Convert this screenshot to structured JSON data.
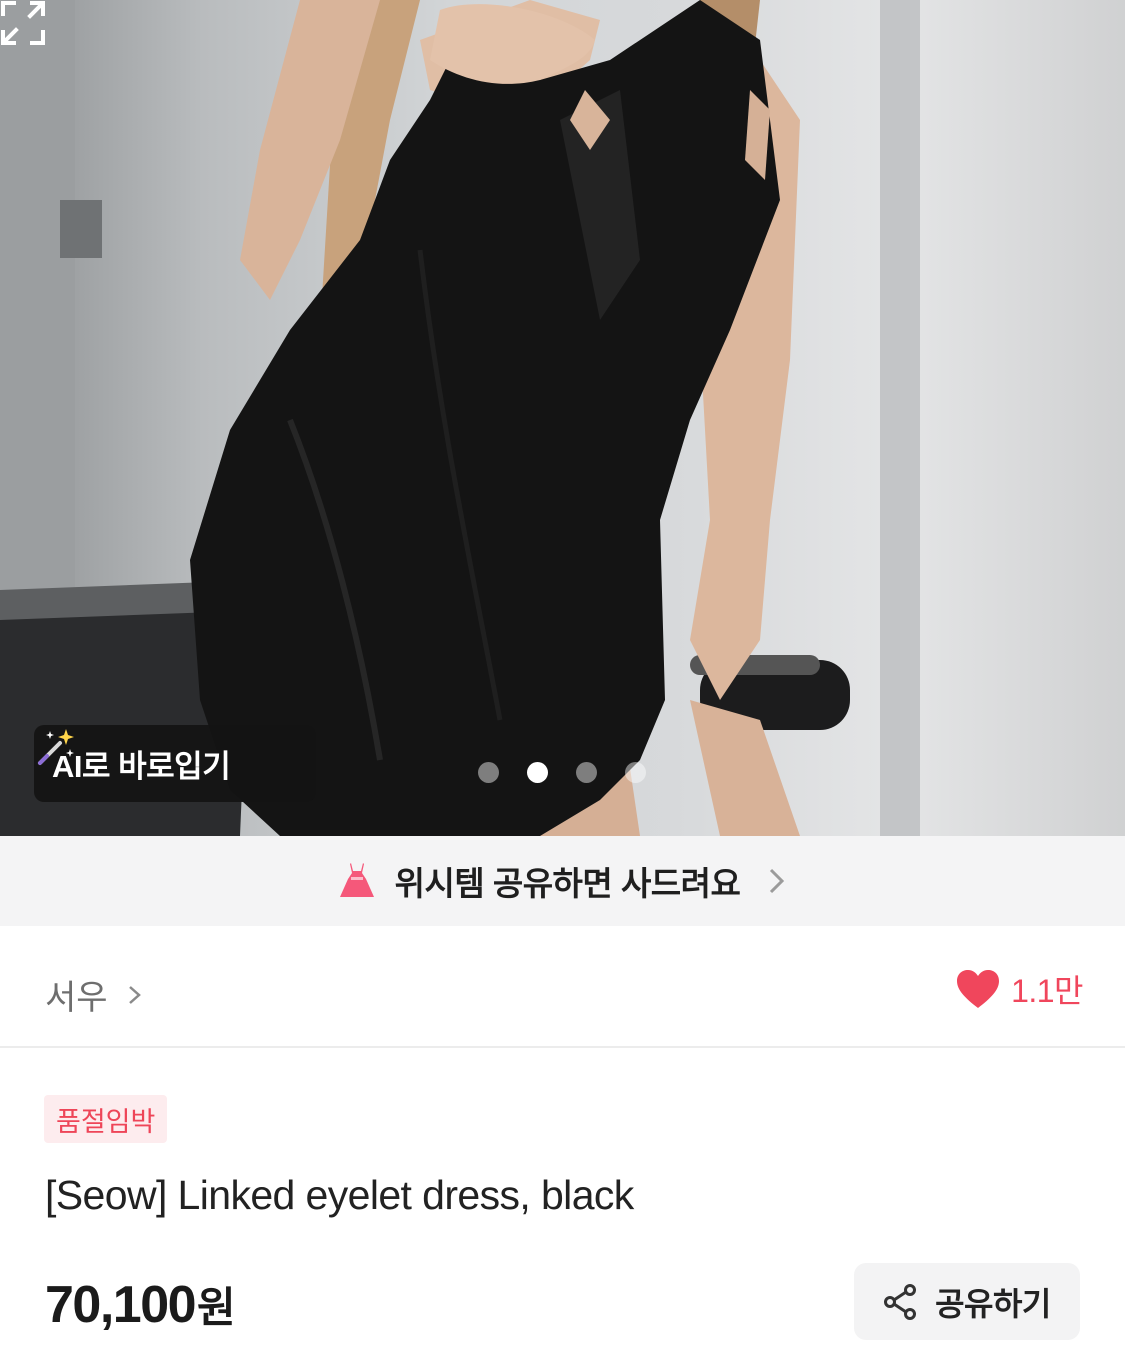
{
  "gallery": {
    "image_alt": "model wearing black linked eyelet dress",
    "ai_try_on_label": "AI로 바로입기",
    "total_images": 4,
    "active_index": 1,
    "icons": {
      "ai": "magic-wand-icon",
      "expand": "expand-icon"
    }
  },
  "promo": {
    "text": "위시템 공유하면 사드려요",
    "icon": "dress-icon",
    "icon_color": "#f5587a"
  },
  "store": {
    "name": "서우",
    "like_count": "1.1만",
    "like_color": "#f0465c"
  },
  "product": {
    "badge": "품절임박",
    "title": "[Seow] Linked eyelet dress, black",
    "price": "70,100",
    "currency": "원"
  },
  "actions": {
    "share_label": "공유하기"
  }
}
